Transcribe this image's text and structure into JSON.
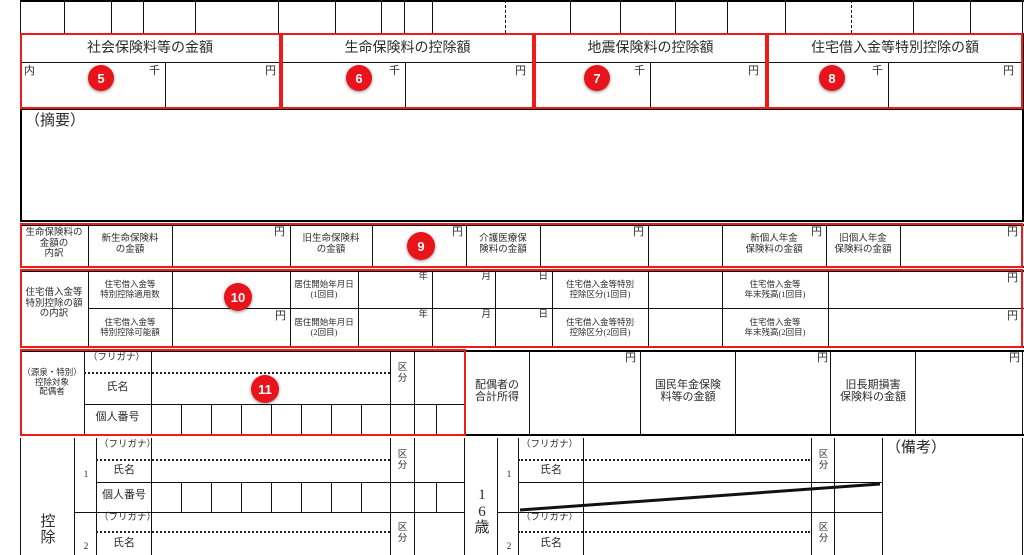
{
  "document": {
    "type": "japanese-withholding-tax-statement",
    "units": {
      "yen": "円",
      "thousand": "千",
      "year": "年",
      "month": "月",
      "day": "日"
    }
  },
  "deduction_headers": [
    {
      "badge": "5",
      "title": "社会保険料等の金額",
      "inner_mark": "内",
      "thousand": "千",
      "yen": "円"
    },
    {
      "badge": "6",
      "title": "生命保険料の控除額",
      "inner_mark": "",
      "thousand": "千",
      "yen": "円"
    },
    {
      "badge": "7",
      "title": "地震保険料の控除額",
      "inner_mark": "",
      "thousand": "千",
      "yen": "円"
    },
    {
      "badge": "8",
      "title": "住宅借入金等特別控除の額",
      "inner_mark": "",
      "thousand": "千",
      "yen": "円"
    }
  ],
  "remarks": {
    "label": "（摘要）",
    "value": ""
  },
  "life_insurance": {
    "row_label": "生命保険料の\n金額の\n内訳",
    "badge": "9",
    "fields": [
      {
        "label": "新生命保険料\nの金額",
        "value": "",
        "unit": "円"
      },
      {
        "label": "旧生命保険料\nの金額",
        "value": "",
        "unit": "円"
      },
      {
        "label": "介護医療保\n険料の金額",
        "value": "",
        "unit": "円"
      },
      {
        "label": "新個人年金\n保険料の金額",
        "value": "",
        "unit": "円"
      },
      {
        "label": "旧個人年金\n保険料の金額",
        "value": "",
        "unit": "円"
      }
    ]
  },
  "housing_loan": {
    "row_label": "住宅借入金等\n特別控除の額\nの内訳",
    "badge": "10",
    "row1": {
      "count_label": "住宅借入金等\n特別控除適用数",
      "count_value": "",
      "move_in_label": "居住開始年月日\n(1回目)",
      "year": "年",
      "month": "月",
      "day": "日",
      "year_value": "",
      "month_value": "",
      "day_value": "",
      "category_label": "住宅借入金等特別\n控除区分(1回目)",
      "category_value": "",
      "balance_label": "住宅借入金等\n年末残高(1回目)",
      "balance_value": "",
      "balance_unit": "円"
    },
    "row2": {
      "count_label": "住宅借入金等\n特別控除可能額",
      "count_value": "",
      "count_unit": "円",
      "move_in_label": "居住開始年月日\n(2回目)",
      "year": "年",
      "month": "月",
      "day": "日",
      "year_value": "",
      "month_value": "",
      "day_value": "",
      "category_label": "住宅借入金等特別\n控除区分(2回目)",
      "category_value": "",
      "balance_label": "住宅借入金等\n年末残高(2回目)",
      "balance_value": "",
      "balance_unit": "円"
    }
  },
  "spouse": {
    "row_label": "（源泉・特別）\n控除対象\n配偶者",
    "badge": "11",
    "furigana_label": "（フリガナ）",
    "furigana_value": "",
    "name_label": "氏名",
    "name_value": "",
    "category_label": "区\n分",
    "category_value": "",
    "mynumber_label": "個人番号",
    "mynumber_digits": [
      "",
      "",
      "",
      "",
      "",
      "",
      "",
      "",
      "",
      "",
      "",
      ""
    ]
  },
  "spouse_income": {
    "label": "配偶者の\n合計所得",
    "value": "",
    "unit": "円"
  },
  "national_pension": {
    "label": "国民年金保険\n料等の金額",
    "value": "",
    "unit": "円"
  },
  "long_term_casualty": {
    "label": "旧長期損害\n保険料の金額",
    "value": "",
    "unit": "円"
  },
  "dependents_left": {
    "row_label": "控\n除",
    "rows": [
      {
        "no": "1",
        "furigana_label": "（フリガナ）",
        "furigana_value": "",
        "name_label": "氏名",
        "name_value": "",
        "category_label": "区\n分",
        "category_value": "",
        "mynumber_label": "個人番号",
        "mynumber_digits": [
          "",
          "",
          "",
          "",
          "",
          "",
          "",
          "",
          "",
          "",
          "",
          ""
        ]
      },
      {
        "no": "2",
        "furigana_label": "（フリガナ）",
        "furigana_value": "",
        "name_label": "氏名",
        "name_value": "",
        "category_label": "区\n分",
        "category_value": ""
      }
    ]
  },
  "dependents_right": {
    "row_label": "1\n6\n歳",
    "rows": [
      {
        "no": "1",
        "furigana_label": "（フリガナ）",
        "furigana_value": "",
        "name_label": "氏名",
        "name_value": "",
        "category_label": "区\n分",
        "category_value": ""
      },
      {
        "no": "2",
        "furigana_label": "（フリガナ）",
        "furigana_value": "",
        "name_label": "氏名",
        "name_value": "",
        "category_label": "区\n分",
        "category_value": ""
      }
    ]
  },
  "notes": {
    "label": "（備考）",
    "value": ""
  },
  "colors": {
    "highlight": "#ee1b1b",
    "badge": "#e8131b",
    "grid": "#111111",
    "text": "#2b2b2b",
    "background": "#ffffff"
  }
}
